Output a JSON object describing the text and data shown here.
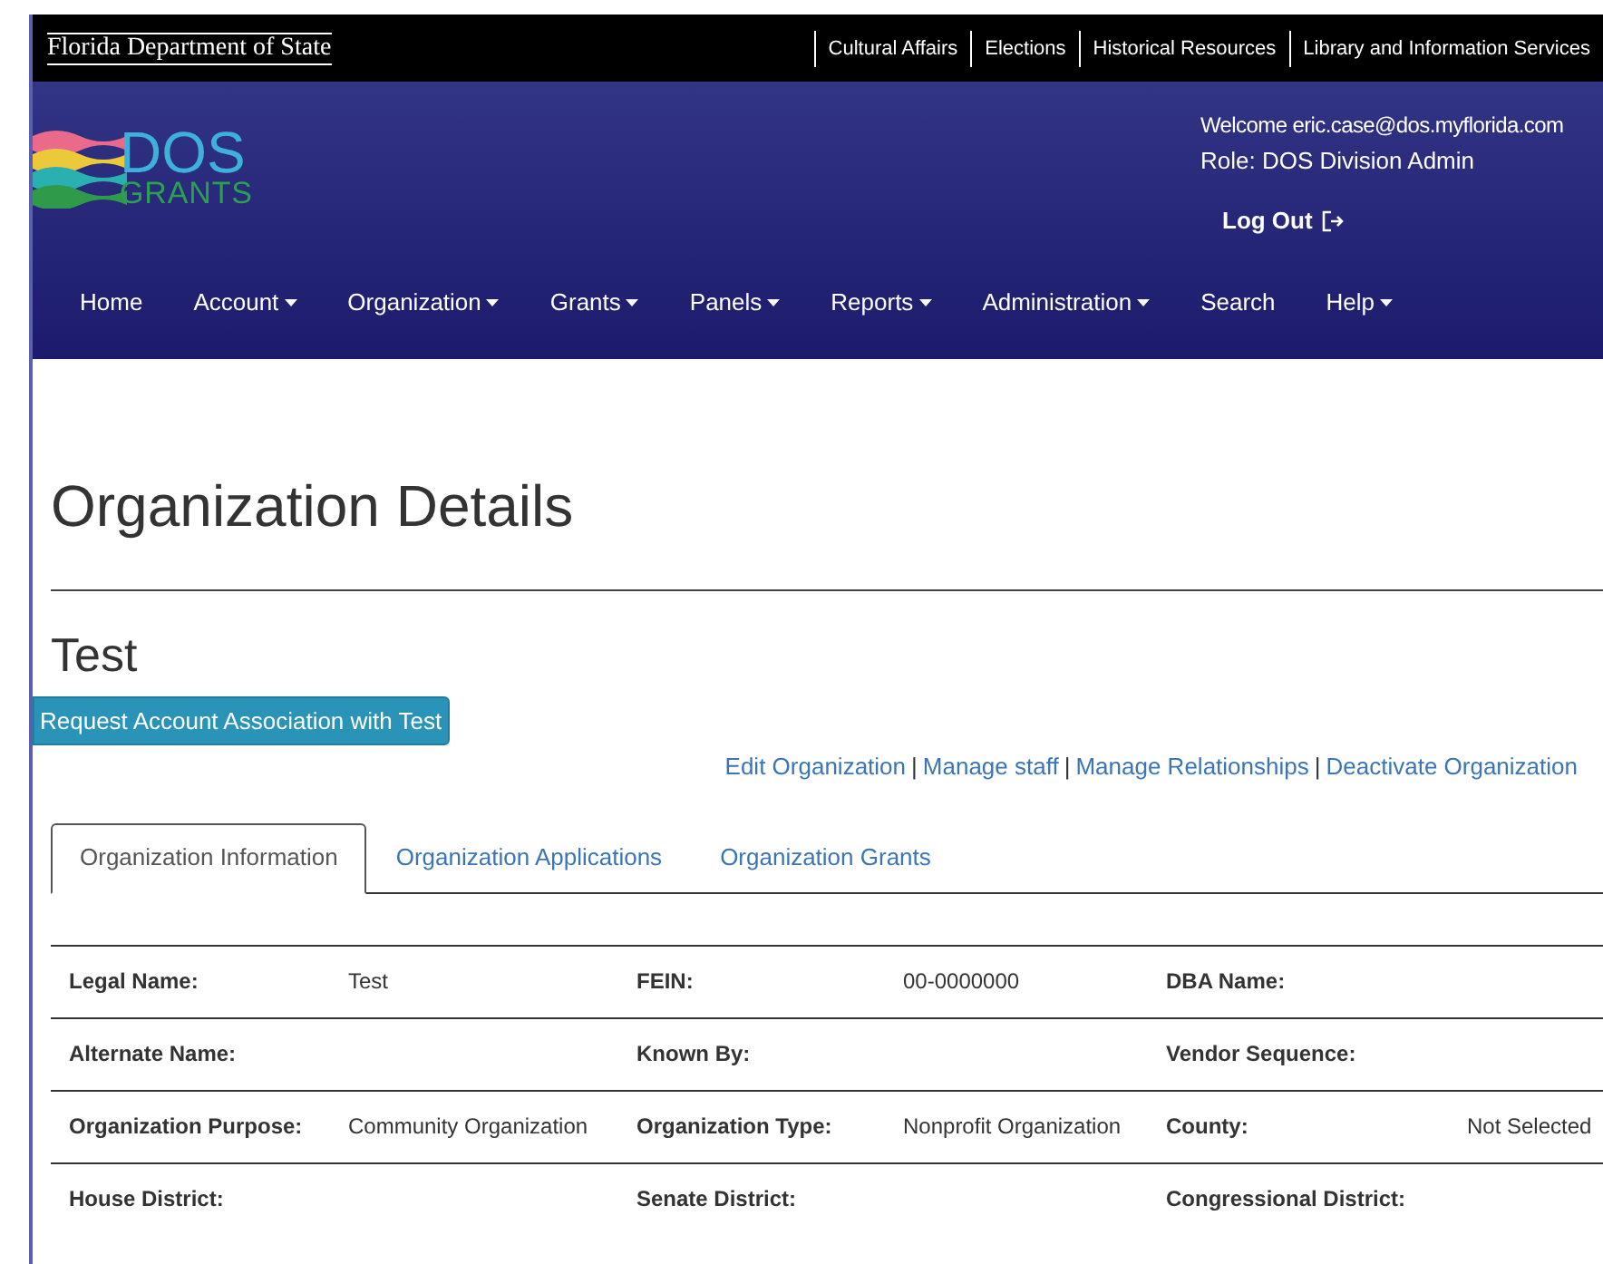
{
  "agency_bar": {
    "title": "Florida Department of State",
    "links": [
      "Cultural Affairs",
      "Elections",
      "Historical Resources",
      "Library and Information Services"
    ]
  },
  "header": {
    "logo_top": "DOS",
    "logo_bottom": "GRANTS",
    "welcome": "Welcome eric.case@dos.myflorida.com",
    "role": "Role: DOS Division Admin",
    "logout": "Log Out"
  },
  "nav": [
    {
      "label": "Home",
      "dropdown": false
    },
    {
      "label": "Account",
      "dropdown": true
    },
    {
      "label": "Organization",
      "dropdown": true
    },
    {
      "label": "Grants",
      "dropdown": true
    },
    {
      "label": "Panels",
      "dropdown": true
    },
    {
      "label": "Reports",
      "dropdown": true
    },
    {
      "label": "Administration",
      "dropdown": true
    },
    {
      "label": "Search",
      "dropdown": false
    },
    {
      "label": "Help",
      "dropdown": true
    }
  ],
  "page_title": "Organization Details",
  "org_name": "Test",
  "request_button": "Request Account Association with Test",
  "actions": [
    "Edit Organization",
    "Manage staff",
    "Manage Relationships",
    "Deactivate Organization"
  ],
  "action_separator": "|",
  "tabs": [
    {
      "label": "Organization Information",
      "selected": true
    },
    {
      "label": "Organization Applications",
      "selected": false
    },
    {
      "label": "Organization Grants",
      "selected": false
    }
  ],
  "details": [
    [
      {
        "label": "Legal Name:",
        "value": "Test"
      },
      {
        "label": "FEIN:",
        "value": "00-0000000"
      },
      {
        "label": "DBA Name:"
      }
    ],
    [
      {
        "label": "Alternate Name:"
      },
      {
        "label": "Known By:"
      },
      {
        "label": "Vendor Sequence:"
      }
    ],
    [
      {
        "label": "Organization Purpose:",
        "value": "Community Organization"
      },
      {
        "label": "Organization Type:",
        "value": "Nonprofit Organization"
      },
      {
        "label": "County:",
        "value": "Not Selected"
      }
    ],
    [
      {
        "label": "House District:"
      },
      {
        "label": "Senate District:"
      },
      {
        "label": "Congressional District:"
      }
    ]
  ]
}
